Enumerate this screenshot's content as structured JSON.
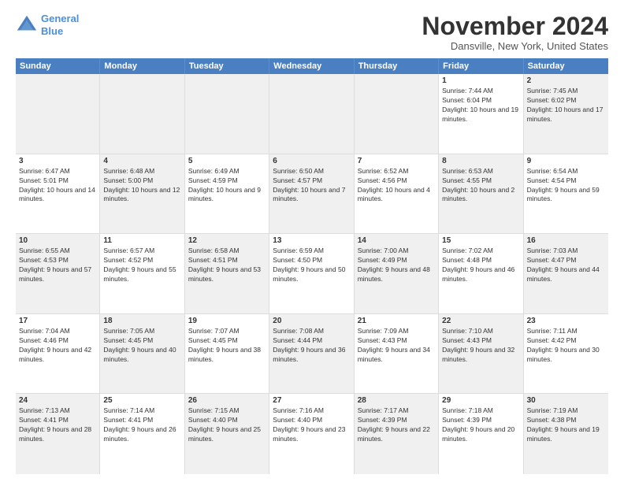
{
  "header": {
    "logo_line1": "General",
    "logo_line2": "Blue",
    "month": "November 2024",
    "location": "Dansville, New York, United States"
  },
  "weekdays": [
    "Sunday",
    "Monday",
    "Tuesday",
    "Wednesday",
    "Thursday",
    "Friday",
    "Saturday"
  ],
  "weeks": [
    [
      {
        "day": "",
        "info": "",
        "shaded": true
      },
      {
        "day": "",
        "info": "",
        "shaded": true
      },
      {
        "day": "",
        "info": "",
        "shaded": true
      },
      {
        "day": "",
        "info": "",
        "shaded": true
      },
      {
        "day": "",
        "info": "",
        "shaded": true
      },
      {
        "day": "1",
        "info": "Sunrise: 7:44 AM\nSunset: 6:04 PM\nDaylight: 10 hours and 19 minutes.",
        "shaded": false
      },
      {
        "day": "2",
        "info": "Sunrise: 7:45 AM\nSunset: 6:02 PM\nDaylight: 10 hours and 17 minutes.",
        "shaded": true
      }
    ],
    [
      {
        "day": "3",
        "info": "Sunrise: 6:47 AM\nSunset: 5:01 PM\nDaylight: 10 hours and 14 minutes.",
        "shaded": false
      },
      {
        "day": "4",
        "info": "Sunrise: 6:48 AM\nSunset: 5:00 PM\nDaylight: 10 hours and 12 minutes.",
        "shaded": true
      },
      {
        "day": "5",
        "info": "Sunrise: 6:49 AM\nSunset: 4:59 PM\nDaylight: 10 hours and 9 minutes.",
        "shaded": false
      },
      {
        "day": "6",
        "info": "Sunrise: 6:50 AM\nSunset: 4:57 PM\nDaylight: 10 hours and 7 minutes.",
        "shaded": true
      },
      {
        "day": "7",
        "info": "Sunrise: 6:52 AM\nSunset: 4:56 PM\nDaylight: 10 hours and 4 minutes.",
        "shaded": false
      },
      {
        "day": "8",
        "info": "Sunrise: 6:53 AM\nSunset: 4:55 PM\nDaylight: 10 hours and 2 minutes.",
        "shaded": true
      },
      {
        "day": "9",
        "info": "Sunrise: 6:54 AM\nSunset: 4:54 PM\nDaylight: 9 hours and 59 minutes.",
        "shaded": false
      }
    ],
    [
      {
        "day": "10",
        "info": "Sunrise: 6:55 AM\nSunset: 4:53 PM\nDaylight: 9 hours and 57 minutes.",
        "shaded": true
      },
      {
        "day": "11",
        "info": "Sunrise: 6:57 AM\nSunset: 4:52 PM\nDaylight: 9 hours and 55 minutes.",
        "shaded": false
      },
      {
        "day": "12",
        "info": "Sunrise: 6:58 AM\nSunset: 4:51 PM\nDaylight: 9 hours and 53 minutes.",
        "shaded": true
      },
      {
        "day": "13",
        "info": "Sunrise: 6:59 AM\nSunset: 4:50 PM\nDaylight: 9 hours and 50 minutes.",
        "shaded": false
      },
      {
        "day": "14",
        "info": "Sunrise: 7:00 AM\nSunset: 4:49 PM\nDaylight: 9 hours and 48 minutes.",
        "shaded": true
      },
      {
        "day": "15",
        "info": "Sunrise: 7:02 AM\nSunset: 4:48 PM\nDaylight: 9 hours and 46 minutes.",
        "shaded": false
      },
      {
        "day": "16",
        "info": "Sunrise: 7:03 AM\nSunset: 4:47 PM\nDaylight: 9 hours and 44 minutes.",
        "shaded": true
      }
    ],
    [
      {
        "day": "17",
        "info": "Sunrise: 7:04 AM\nSunset: 4:46 PM\nDaylight: 9 hours and 42 minutes.",
        "shaded": false
      },
      {
        "day": "18",
        "info": "Sunrise: 7:05 AM\nSunset: 4:45 PM\nDaylight: 9 hours and 40 minutes.",
        "shaded": true
      },
      {
        "day": "19",
        "info": "Sunrise: 7:07 AM\nSunset: 4:45 PM\nDaylight: 9 hours and 38 minutes.",
        "shaded": false
      },
      {
        "day": "20",
        "info": "Sunrise: 7:08 AM\nSunset: 4:44 PM\nDaylight: 9 hours and 36 minutes.",
        "shaded": true
      },
      {
        "day": "21",
        "info": "Sunrise: 7:09 AM\nSunset: 4:43 PM\nDaylight: 9 hours and 34 minutes.",
        "shaded": false
      },
      {
        "day": "22",
        "info": "Sunrise: 7:10 AM\nSunset: 4:43 PM\nDaylight: 9 hours and 32 minutes.",
        "shaded": true
      },
      {
        "day": "23",
        "info": "Sunrise: 7:11 AM\nSunset: 4:42 PM\nDaylight: 9 hours and 30 minutes.",
        "shaded": false
      }
    ],
    [
      {
        "day": "24",
        "info": "Sunrise: 7:13 AM\nSunset: 4:41 PM\nDaylight: 9 hours and 28 minutes.",
        "shaded": true
      },
      {
        "day": "25",
        "info": "Sunrise: 7:14 AM\nSunset: 4:41 PM\nDaylight: 9 hours and 26 minutes.",
        "shaded": false
      },
      {
        "day": "26",
        "info": "Sunrise: 7:15 AM\nSunset: 4:40 PM\nDaylight: 9 hours and 25 minutes.",
        "shaded": true
      },
      {
        "day": "27",
        "info": "Sunrise: 7:16 AM\nSunset: 4:40 PM\nDaylight: 9 hours and 23 minutes.",
        "shaded": false
      },
      {
        "day": "28",
        "info": "Sunrise: 7:17 AM\nSunset: 4:39 PM\nDaylight: 9 hours and 22 minutes.",
        "shaded": true
      },
      {
        "day": "29",
        "info": "Sunrise: 7:18 AM\nSunset: 4:39 PM\nDaylight: 9 hours and 20 minutes.",
        "shaded": false
      },
      {
        "day": "30",
        "info": "Sunrise: 7:19 AM\nSunset: 4:38 PM\nDaylight: 9 hours and 19 minutes.",
        "shaded": true
      }
    ]
  ]
}
